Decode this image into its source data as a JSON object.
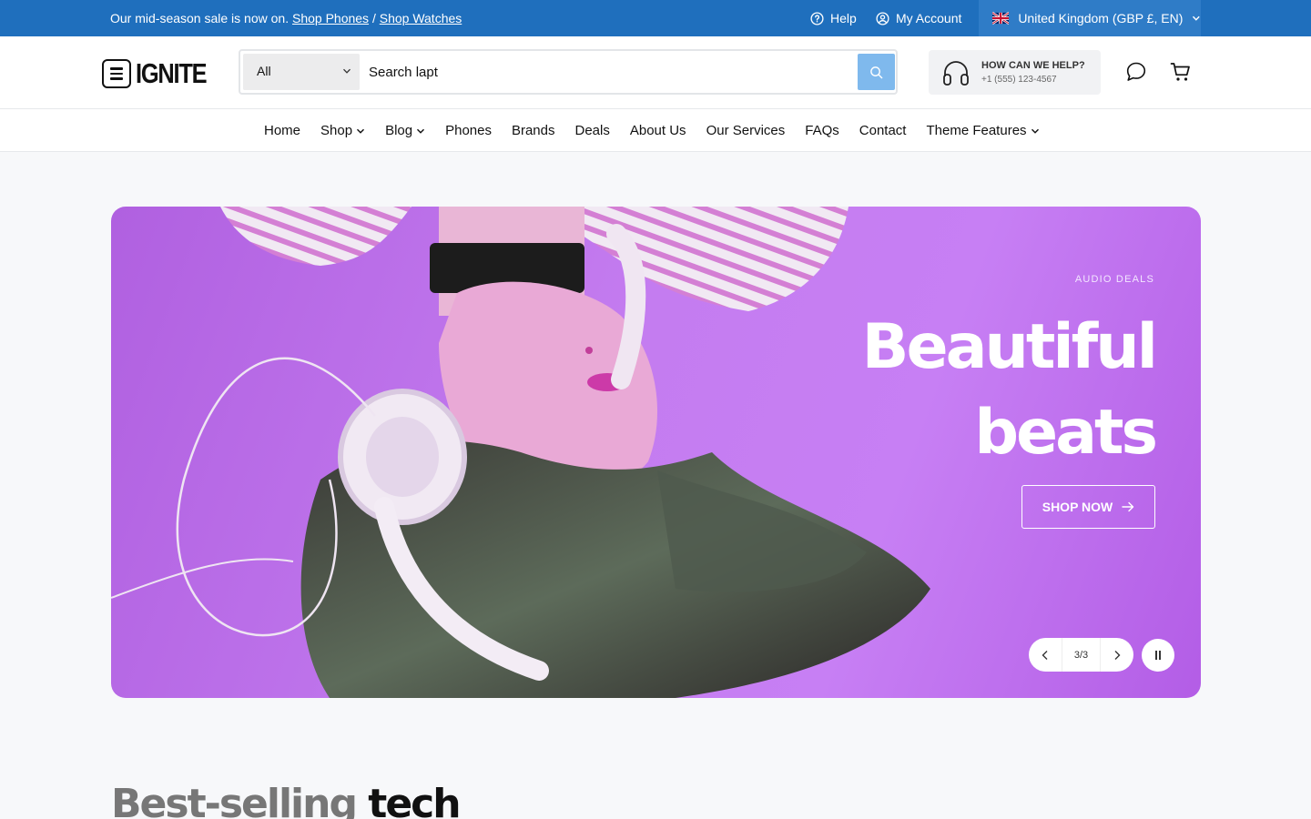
{
  "announcement": {
    "text": "Our mid-season sale is now on.",
    "link1": "Shop Phones",
    "separator": "/",
    "link2": "Shop Watches"
  },
  "topbar": {
    "help_label": "Help",
    "account_label": "My Account",
    "locale_label": "United Kingdom (GBP £, EN)"
  },
  "header": {
    "logo_text": "IGNITE",
    "search": {
      "category": "All",
      "value": "Search lapt"
    },
    "support": {
      "title": "HOW CAN WE HELP?",
      "phone": "+1 (555) 123-4567"
    }
  },
  "nav": {
    "items": [
      {
        "label": "Home"
      },
      {
        "label": "Shop"
      },
      {
        "label": "Blog"
      },
      {
        "label": "Phones"
      },
      {
        "label": "Brands"
      },
      {
        "label": "Deals"
      },
      {
        "label": "About Us"
      },
      {
        "label": "Our Services"
      },
      {
        "label": "FAQs"
      },
      {
        "label": "Contact"
      },
      {
        "label": "Theme Features"
      }
    ]
  },
  "hero": {
    "eyebrow": "AUDIO DEALS",
    "headline_line1": "Beautiful",
    "headline_line2": "beats",
    "cta_label": "SHOP NOW",
    "slide_counter": "3/3",
    "accent_color": "#c47cf0"
  },
  "section": {
    "title_muted": "Best-selling",
    "title_strong": "tech"
  },
  "colors": {
    "topbar_bg": "#1f6fbd",
    "search_button": "#7fb9ed"
  }
}
